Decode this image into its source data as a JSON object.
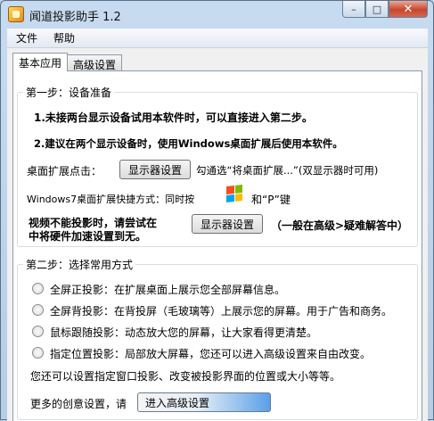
{
  "window": {
    "title": "闻道投影助手 1.2",
    "minimize": "–",
    "maximize": "□",
    "close": "✕"
  },
  "menu": [
    "文件",
    "帮助"
  ],
  "tabs": [
    "基本应用",
    "高级设置"
  ],
  "step1": {
    "title": "第一步：设备准备",
    "line1": "1.未接两台显示设备试用本软件时，可以直接进入第二步。",
    "line2": "2.建议在两个显示设备时，使用Windows桌面扩展后使用本软件。",
    "extend_label": "桌面扩展点击：",
    "display_btn": "显示器设置",
    "extend_hint": "勾通选“将桌面扩展...”(双显示器时可用)",
    "shortcut_label": "Windows7桌面扩展快捷方式：同时按",
    "shortcut_key": "和“P”键",
    "noproj_line1": "视频不能投影时，请尝试在",
    "noproj_line2": "中将硬件加速设置到无。",
    "display_btn2": "显示器设置",
    "noproj_hint": "（一般在高级>疑难解答中）"
  },
  "step2": {
    "title": "第二步：选择常用方式",
    "options": [
      "全屏正投影：在扩展桌面上展示您全部屏幕信息。",
      "全屏背投影：在背投屏（毛玻璃等）上展示您的屏幕。用于广告和商务。",
      "鼠标跟随投影：动态放大您的屏幕，让大家看得更清楚。",
      "指定位置投影：局部放大屏幕，您还可以进入高级设置来自由改变。"
    ],
    "extra_note": "您还可以设置指定窗口投影、改变被投影界面的位置或大小等等。",
    "more_label": "更多的创意设置，请",
    "advanced_btn": "进入高级设置"
  }
}
